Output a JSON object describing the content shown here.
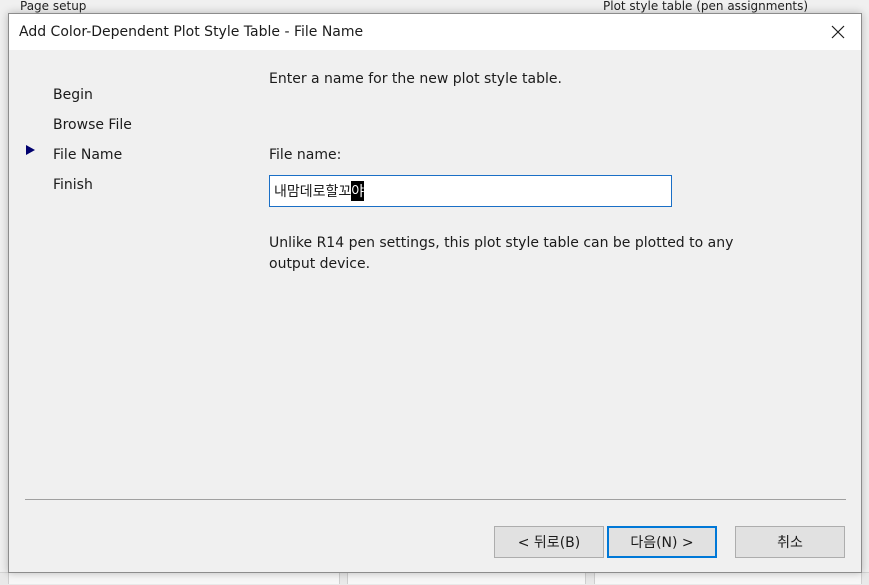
{
  "background": {
    "left_label": "Page setup",
    "right_label": "Plot style table (pen assignments)"
  },
  "dialog": {
    "title": "Add Color-Dependent Plot Style Table - File Name",
    "close_icon": "close-icon"
  },
  "steps": [
    {
      "label": "Begin",
      "current": false
    },
    {
      "label": "Browse File",
      "current": false
    },
    {
      "label": "File Name",
      "current": true
    },
    {
      "label": "Finish",
      "current": false
    }
  ],
  "current_step_icon": "arrow-right-icon",
  "content": {
    "instruction": "Enter a name for the new plot style table.",
    "filename_label": "File name:",
    "filename_value": "내맘데로할꼬",
    "filename_composing": "야",
    "note": "Unlike R14 pen settings, this plot style table can be plotted to any output device."
  },
  "buttons": {
    "back": "< 뒤로(B)",
    "next": "다음(N) >",
    "cancel": "취소"
  },
  "colors": {
    "accent": "#0078d7",
    "step_arrow": "#00006e"
  }
}
